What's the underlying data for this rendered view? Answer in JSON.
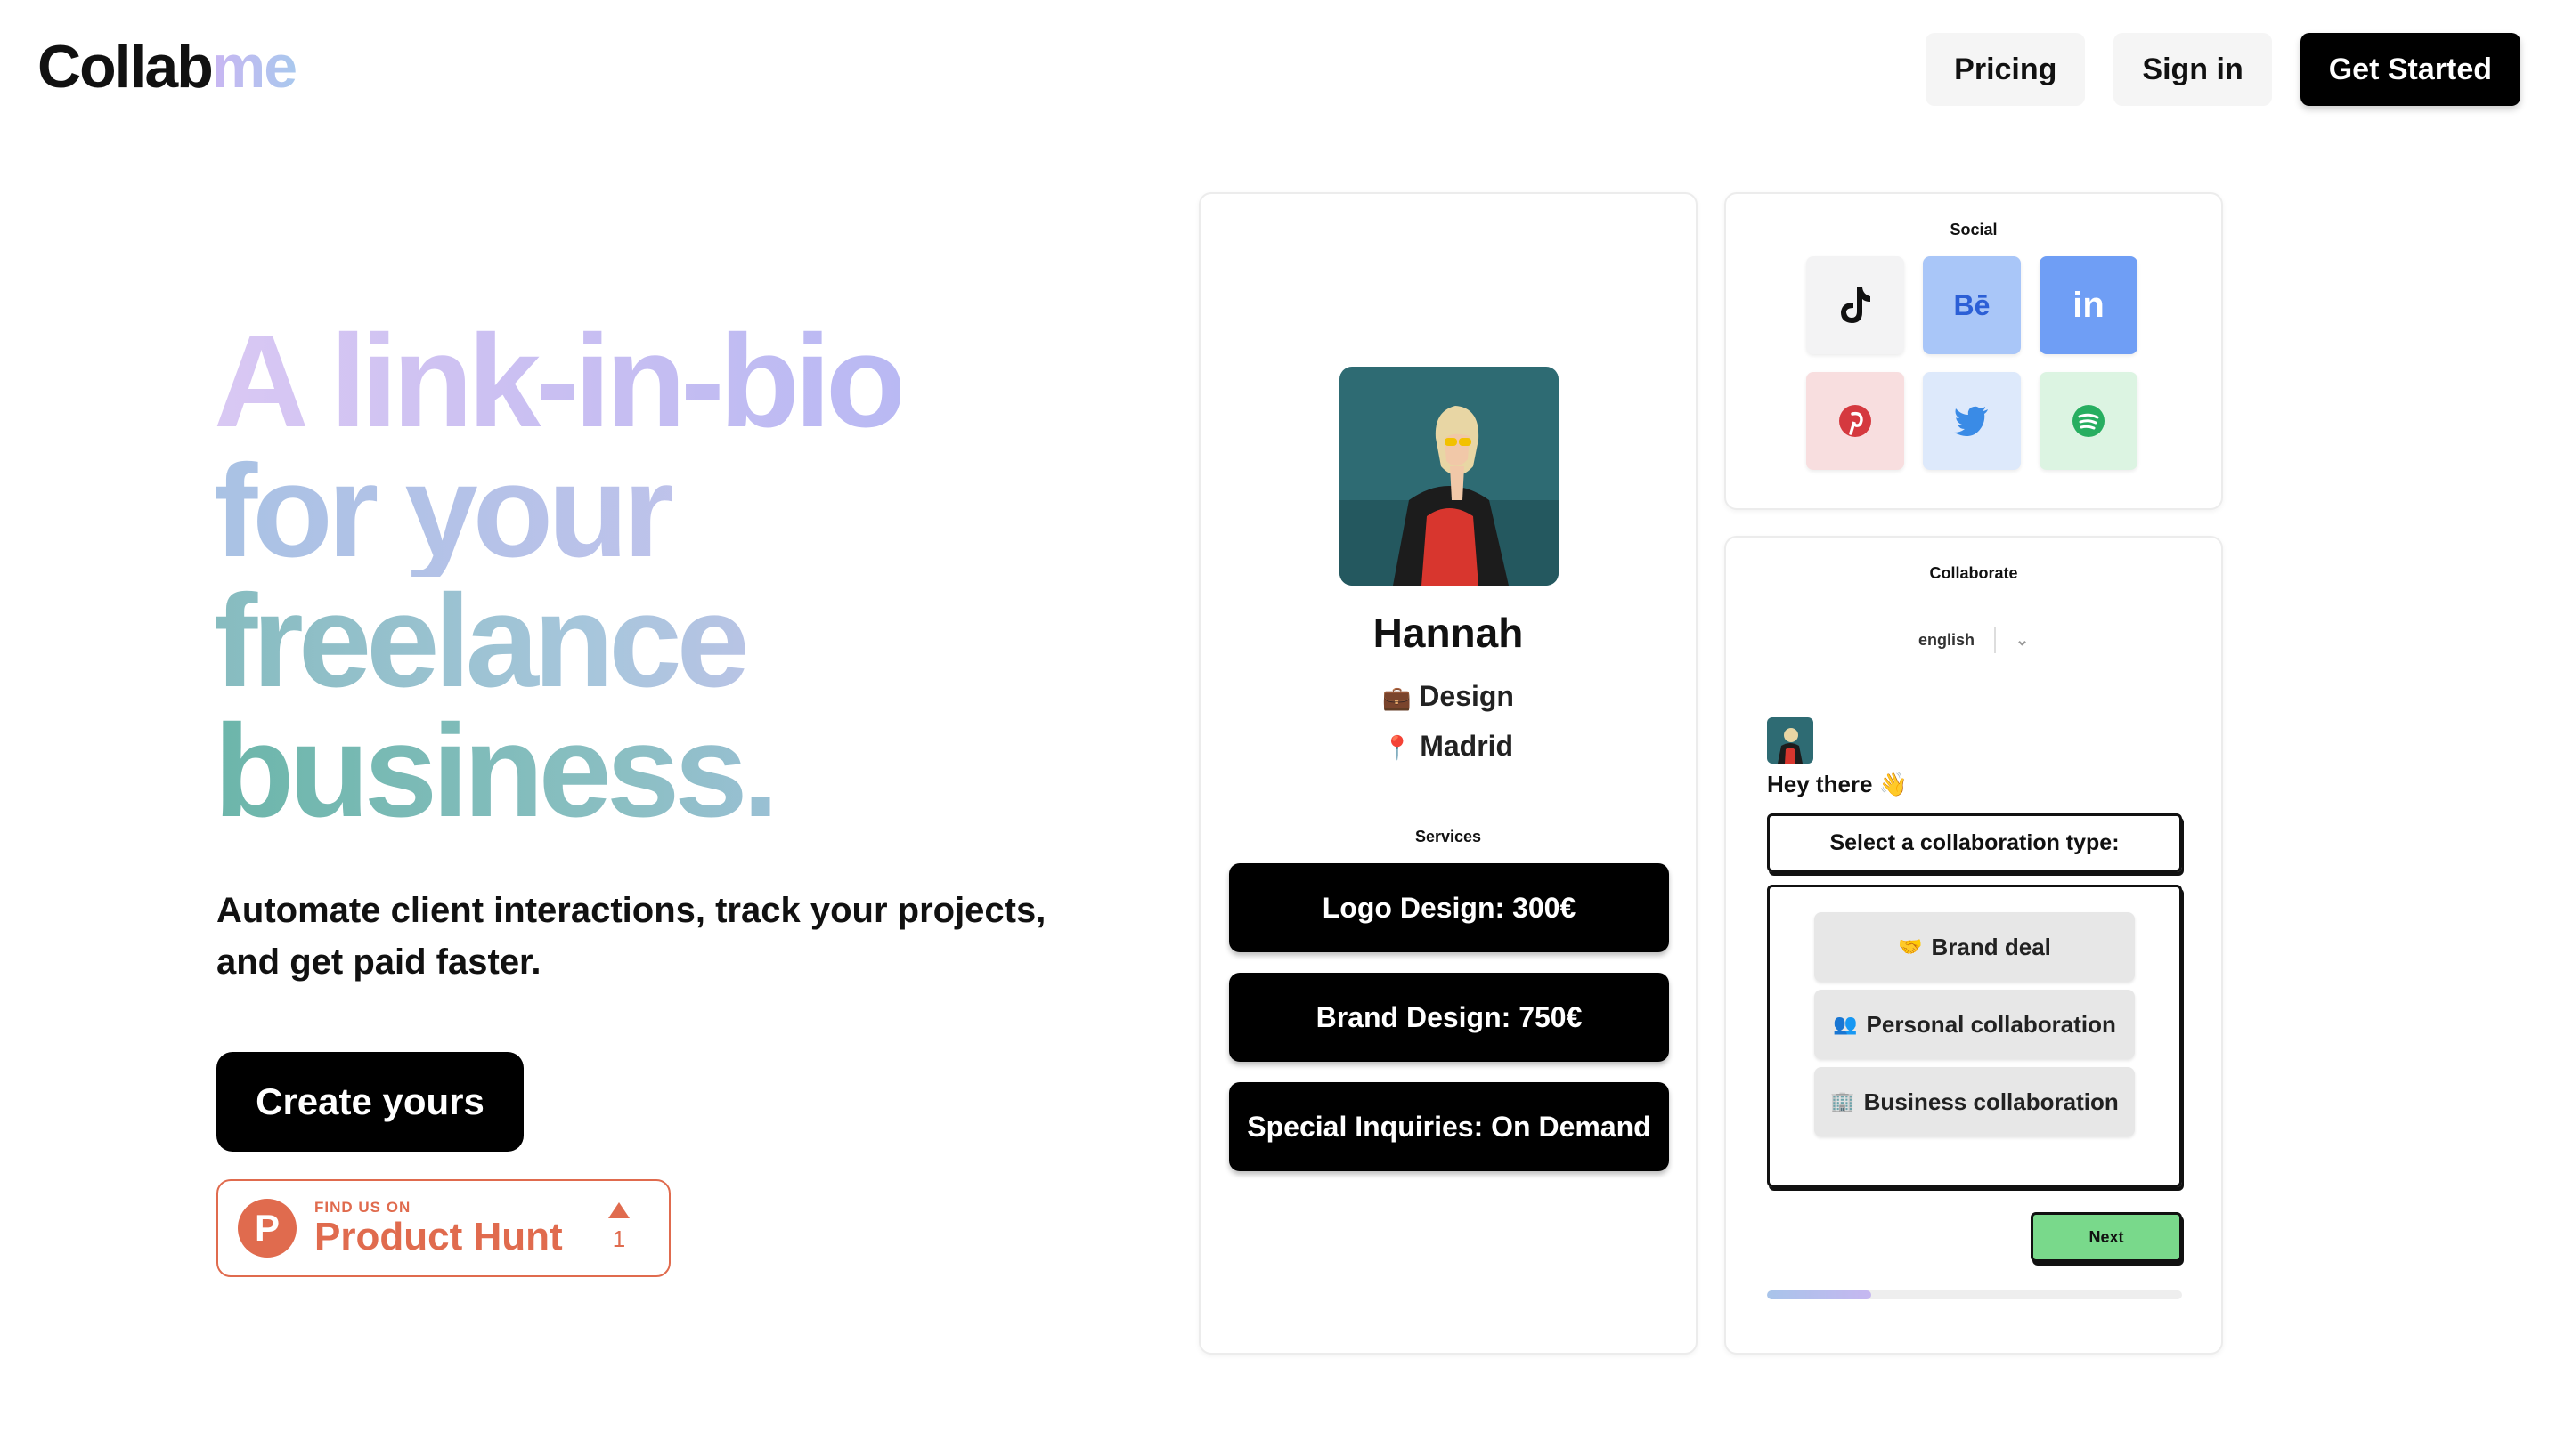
{
  "header": {
    "logo_part1": "Collab",
    "logo_part2": "me",
    "nav": {
      "pricing": "Pricing",
      "signin": "Sign in",
      "get_started": "Get Started"
    }
  },
  "hero": {
    "title_lines": [
      "A link-in-bio",
      "for your",
      "freelance",
      "business."
    ],
    "subtitle": "Automate client interactions, track your projects, and get paid faster.",
    "cta": "Create yours",
    "product_hunt": {
      "small": "FIND US ON",
      "big": "Product Hunt",
      "count": "1"
    }
  },
  "profile": {
    "name": "Hannah",
    "role": "Design",
    "location": "Madrid",
    "services_label": "Services",
    "services": [
      "Logo Design: 300€",
      "Brand Design: 750€",
      "Special Inquiries: On Demand"
    ]
  },
  "social": {
    "label": "Social",
    "icons": [
      {
        "icon": "tiktok-icon",
        "glyph": "♪",
        "bg": "#f3f3f4",
        "fg": "#111111"
      },
      {
        "icon": "behance-icon",
        "glyph": "Bē",
        "bg": "#a9c6f8",
        "fg": "#2c5fd6"
      },
      {
        "icon": "linkedin-icon",
        "glyph": "in",
        "bg": "#6f9ef5",
        "fg": "#ffffff"
      },
      {
        "icon": "pinterest-icon",
        "glyph": "P",
        "bg": "#f8dedf",
        "fg": "#d5393f"
      },
      {
        "icon": "twitter-icon",
        "glyph": "🐦",
        "bg": "#dde9fb",
        "fg": "#3a8be6"
      },
      {
        "icon": "spotify-icon",
        "glyph": "≋",
        "bg": "#dcf4e2",
        "fg": "#27ae60"
      }
    ]
  },
  "collab": {
    "label": "Collaborate",
    "language": "english",
    "greeting": "Hey there 👋",
    "select_prompt": "Select a collaboration type:",
    "options": [
      {
        "icon": "handshake-icon",
        "glyph": "🤝",
        "label": "Brand deal"
      },
      {
        "icon": "people-icon",
        "glyph": "👥",
        "label": "Personal collaboration"
      },
      {
        "icon": "building-icon",
        "glyph": "🏢",
        "label": "Business collaboration"
      }
    ],
    "next": "Next",
    "progress": 0.25
  },
  "colors": {
    "accent_black": "#000000",
    "next_green": "#79d98b",
    "product_hunt": "#e06b4e"
  }
}
